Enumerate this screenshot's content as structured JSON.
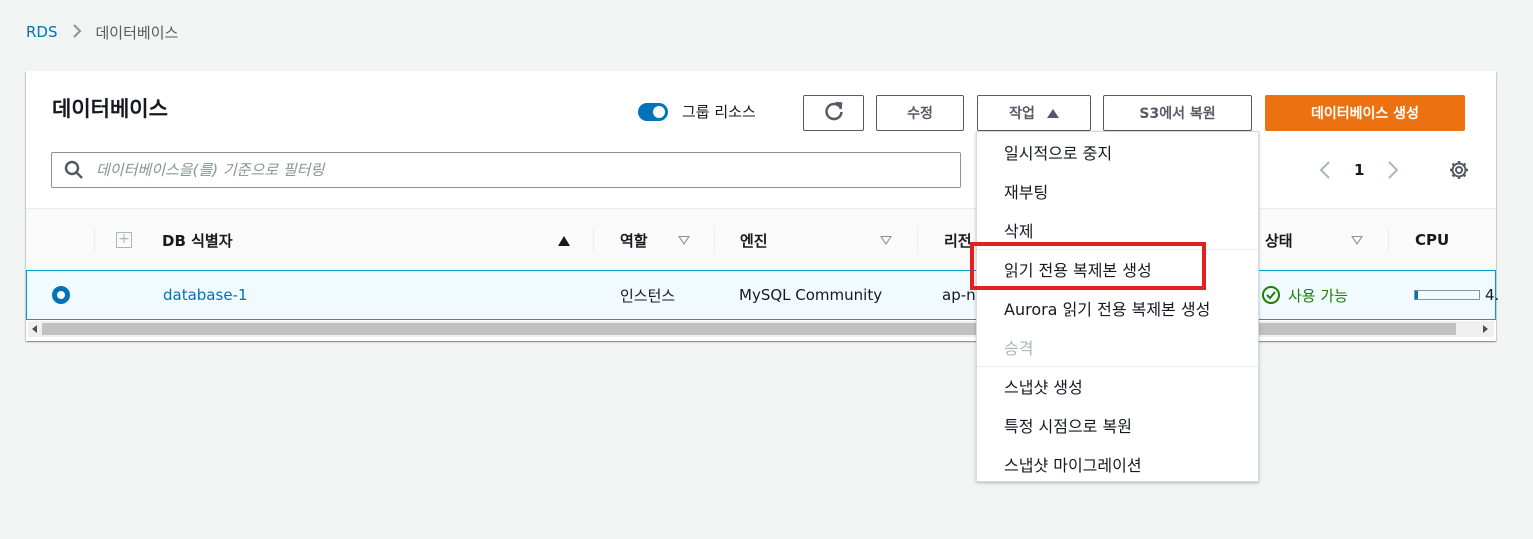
{
  "breadcrumb": {
    "root": "RDS",
    "separator": ">",
    "current": "데이터베이스"
  },
  "panel": {
    "title": "데이터베이스"
  },
  "toolbar": {
    "group_toggle_label": "그룹 리소스",
    "edit": "수정",
    "actions": "작업",
    "restore_s3": "S3에서 복원",
    "create": "데이터베이스 생성"
  },
  "search": {
    "placeholder": "데이터베이스을(를) 기준으로 필터링",
    "value": ""
  },
  "pagination": {
    "page": "1"
  },
  "table": {
    "columns": [
      "DB 식별자",
      "역할",
      "엔진",
      "리전",
      "상태",
      "CPU"
    ],
    "rows": [
      {
        "id": "database-1",
        "role": "인스턴스",
        "engine": "MySQL Community",
        "region": "ap-n",
        "status": "사용 가능",
        "cpu_text": "4.",
        "cpu_fraction": 0.05
      }
    ]
  },
  "actions_menu": {
    "items": [
      {
        "label": "일시적으로 중지",
        "disabled": false
      },
      {
        "label": "재부팅",
        "disabled": false
      },
      {
        "label": "삭제",
        "disabled": false
      },
      {
        "label": "읽기 전용 복제본 생성",
        "disabled": false,
        "highlighted": true
      },
      {
        "label": "Aurora 읽기 전용 복제본 생성",
        "disabled": false
      },
      {
        "label": "승격",
        "disabled": true
      },
      {
        "label": "스냅샷 생성",
        "disabled": false
      },
      {
        "label": "특정 시점으로 복원",
        "disabled": false
      },
      {
        "label": "스냅샷 마이그레이션",
        "disabled": false
      }
    ]
  },
  "colors": {
    "accent": "#0073bb",
    "primary_button": "#ec7211",
    "status_ok": "#1d8102",
    "highlight_box": "#e41f1f"
  }
}
